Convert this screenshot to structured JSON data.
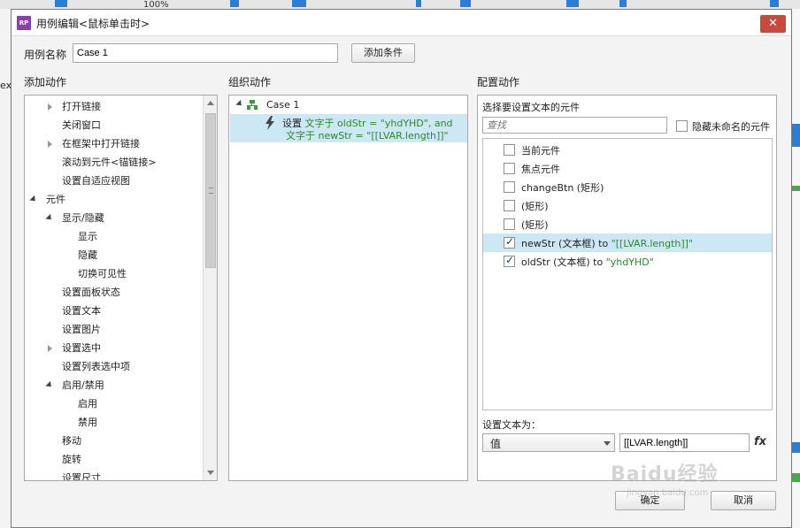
{
  "background": {
    "zoom": "100%",
    "left_cut_text": "ex"
  },
  "dialog": {
    "app_icon": "RP",
    "title": "用例编辑<鼠标单击时>",
    "close_glyph": "✕",
    "case_name_label": "用例名称",
    "case_name_value": "Case 1",
    "add_condition_label": "添加条件",
    "ok_label": "确定",
    "cancel_label": "取消"
  },
  "add_actions": {
    "heading": "添加动作",
    "items": [
      {
        "label": "打开链接",
        "expander": "collapsed"
      },
      {
        "label": "关闭窗口",
        "expander": "none"
      },
      {
        "label": "在框架中打开链接",
        "expander": "collapsed"
      },
      {
        "label": "滚动到元件<锚链接>",
        "expander": "none"
      },
      {
        "label": "设置自适应视图",
        "expander": "none"
      },
      {
        "label": "元件",
        "expander": "expanded"
      },
      {
        "label": "显示/隐藏",
        "expander": "expanded"
      },
      {
        "label": "显示",
        "expander": "none"
      },
      {
        "label": "隐藏",
        "expander": "none"
      },
      {
        "label": "切换可见性",
        "expander": "none"
      },
      {
        "label": "设置面板状态",
        "expander": "none"
      },
      {
        "label": "设置文本",
        "expander": "none"
      },
      {
        "label": "设置图片",
        "expander": "none"
      },
      {
        "label": "设置选中",
        "expander": "collapsed"
      },
      {
        "label": "设置列表选中项",
        "expander": "none"
      },
      {
        "label": "启用/禁用",
        "expander": "expanded"
      },
      {
        "label": "启用",
        "expander": "none"
      },
      {
        "label": "禁用",
        "expander": "none"
      },
      {
        "label": "移动",
        "expander": "none"
      },
      {
        "label": "旋转",
        "expander": "none"
      },
      {
        "label": "设置尺寸",
        "expander": "none"
      }
    ]
  },
  "organize_actions": {
    "heading": "组织动作",
    "case_label": "Case 1",
    "action_prefix": "设置",
    "action_line1": "文字于 oldStr = \"yhdYHD\", and",
    "action_line2": "文字于 newStr = \"[[LVAR.length]]\""
  },
  "configure_actions": {
    "heading": "配置动作",
    "select_label": "选择要设置文本的元件",
    "search_placeholder": "查找",
    "hide_unnamed_label": "隐藏未命名的元件",
    "widgets": [
      {
        "name": "当前元件",
        "checked": false,
        "suffix": ""
      },
      {
        "name": "焦点元件",
        "checked": false,
        "suffix": ""
      },
      {
        "name": "changeBtn (矩形)",
        "checked": false,
        "suffix": ""
      },
      {
        "name": "(矩形)",
        "checked": false,
        "suffix": ""
      },
      {
        "name": "(矩形)",
        "checked": false,
        "suffix": ""
      },
      {
        "name": "newStr (文本框) to ",
        "checked": true,
        "suffix": "\"[[LVAR.length]]\""
      },
      {
        "name": "oldStr (文本框) to ",
        "checked": true,
        "suffix": "\"yhdYHD\""
      }
    ],
    "set_text_label": "设置文本为：",
    "value_type": "值",
    "value_text": "[[LVAR.length]]",
    "fx_label": "fx"
  },
  "watermark": {
    "main": "Baidu经验",
    "sub": "jingyan.baidu.com"
  },
  "colors": {
    "selection": "#cce8f4",
    "green_text": "#2a8a2a",
    "close_red": "#c74a3c",
    "app_icon_purple": "#8b3fa8"
  }
}
